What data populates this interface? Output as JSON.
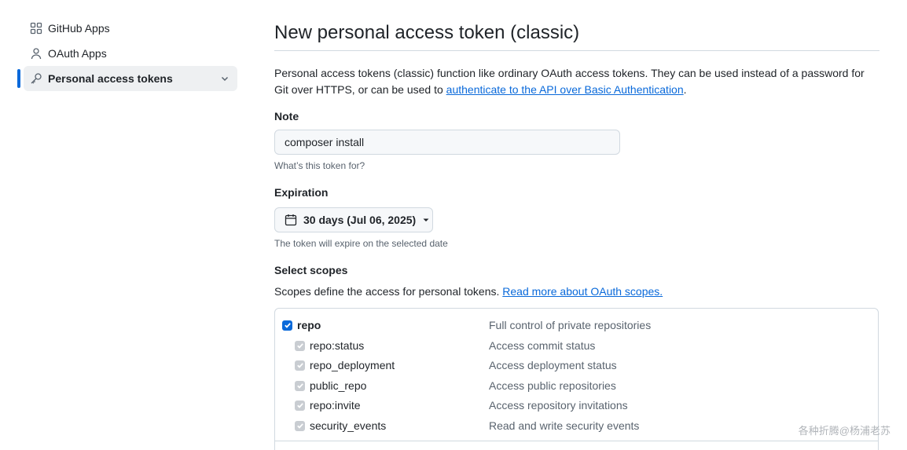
{
  "sidebar": {
    "items": [
      {
        "label": "GitHub Apps",
        "icon": "apps-icon"
      },
      {
        "label": "OAuth Apps",
        "icon": "person-icon"
      },
      {
        "label": "Personal access tokens",
        "icon": "key-icon",
        "active": true
      }
    ]
  },
  "main": {
    "title": "New personal access token (classic)",
    "intro_text": "Personal access tokens (classic) function like ordinary OAuth access tokens. They can be used instead of a password for Git over HTTPS, or can be used to ",
    "intro_link": "authenticate to the API over Basic Authentication",
    "intro_end": ".",
    "note": {
      "label": "Note",
      "value": "composer install",
      "hint": "What’s this token for?"
    },
    "expiration": {
      "label": "Expiration",
      "selected": "30 days (Jul 06, 2025)",
      "hint": "The token will expire on the selected date"
    },
    "scopes": {
      "label": "Select scopes",
      "desc_text": "Scopes define the access for personal tokens. ",
      "desc_link": "Read more about OAuth scopes.",
      "items": [
        {
          "name": "repo",
          "desc": "Full control of private repositories",
          "checked": true,
          "parent": true
        },
        {
          "name": "repo:status",
          "desc": "Access commit status",
          "checked": true
        },
        {
          "name": "repo_deployment",
          "desc": "Access deployment status",
          "checked": true
        },
        {
          "name": "public_repo",
          "desc": "Access public repositories",
          "checked": true
        },
        {
          "name": "repo:invite",
          "desc": "Access repository invitations",
          "checked": true
        },
        {
          "name": "security_events",
          "desc": "Read and write security events",
          "checked": true
        }
      ]
    }
  },
  "watermark": "各种折腾@杨浦老苏",
  "colors": {
    "accent": "#0969da",
    "active_bg": "#eef0f2",
    "border": "#d1d9e0",
    "muted": "#59636e"
  }
}
